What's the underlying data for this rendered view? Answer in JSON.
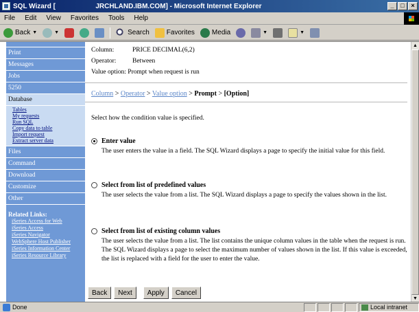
{
  "window": {
    "title_left": "SQL Wizard [",
    "title_right": "JRCHLAND.IBM.COM] - Microsoft Internet Explorer",
    "minimize": "_",
    "maximize": "□",
    "close": "×"
  },
  "menubar": [
    "File",
    "Edit",
    "View",
    "Favorites",
    "Tools",
    "Help"
  ],
  "toolbar": {
    "back_label": "Back",
    "search_label": "Search",
    "favorites_label": "Favorites",
    "media_label": "Media"
  },
  "leftnav": {
    "items": [
      "Print",
      "Messages",
      "Jobs",
      "5250",
      "Database"
    ],
    "database_links": [
      "Tables",
      "My requests",
      "Run SQL",
      "Copy data to table",
      "Import request",
      "Extract server data"
    ],
    "items_after": [
      "Files",
      "Command",
      "Download",
      "Customize",
      "Other"
    ],
    "related_title": "Related Links:",
    "related_links": [
      "iSeries Access for Web",
      "iSeries Access",
      "iSeries Navigator",
      "WebSphere Host Publisher",
      "iSeries Information Center",
      "iSeries Resource Library"
    ]
  },
  "main": {
    "column_key": "Column:",
    "column_value": "PRICE DECIMAL(6,2)",
    "operator_key": "Operator:",
    "operator_value": "Between",
    "value_option_text": "Value option: Prompt when request is run",
    "crumbs": {
      "column": "Column",
      "operator": "Operator",
      "value_option": "Value option",
      "prompt": "Prompt",
      "option": "[Option]",
      "sep": " > "
    },
    "instruction": "Select how the condition value is specified.",
    "options": [
      {
        "label": "Enter value",
        "selected": true,
        "description": "The user enters the value in a field. The SQL Wizard displays a page to specify the initial value for this field."
      },
      {
        "label": "Select from list of predefined values",
        "selected": false,
        "description": "The user selects the value from a list. The SQL Wizard displays a page to specify the values shown in the list."
      },
      {
        "label": "Select from list of existing column values",
        "selected": false,
        "description": "The user selects the value from a list. The list contains the unique column values in the table when the request is run. The SQL Wizard displays a page to select the maximum number of values shown in the list. If this value is exceeded, the list is replaced with a field for the user to enter the value."
      }
    ],
    "buttons": {
      "back": "Back",
      "next": "Next",
      "apply": "Apply",
      "cancel": "Cancel"
    }
  },
  "statusbar": {
    "status": "Done",
    "zone": "Local intranet"
  }
}
